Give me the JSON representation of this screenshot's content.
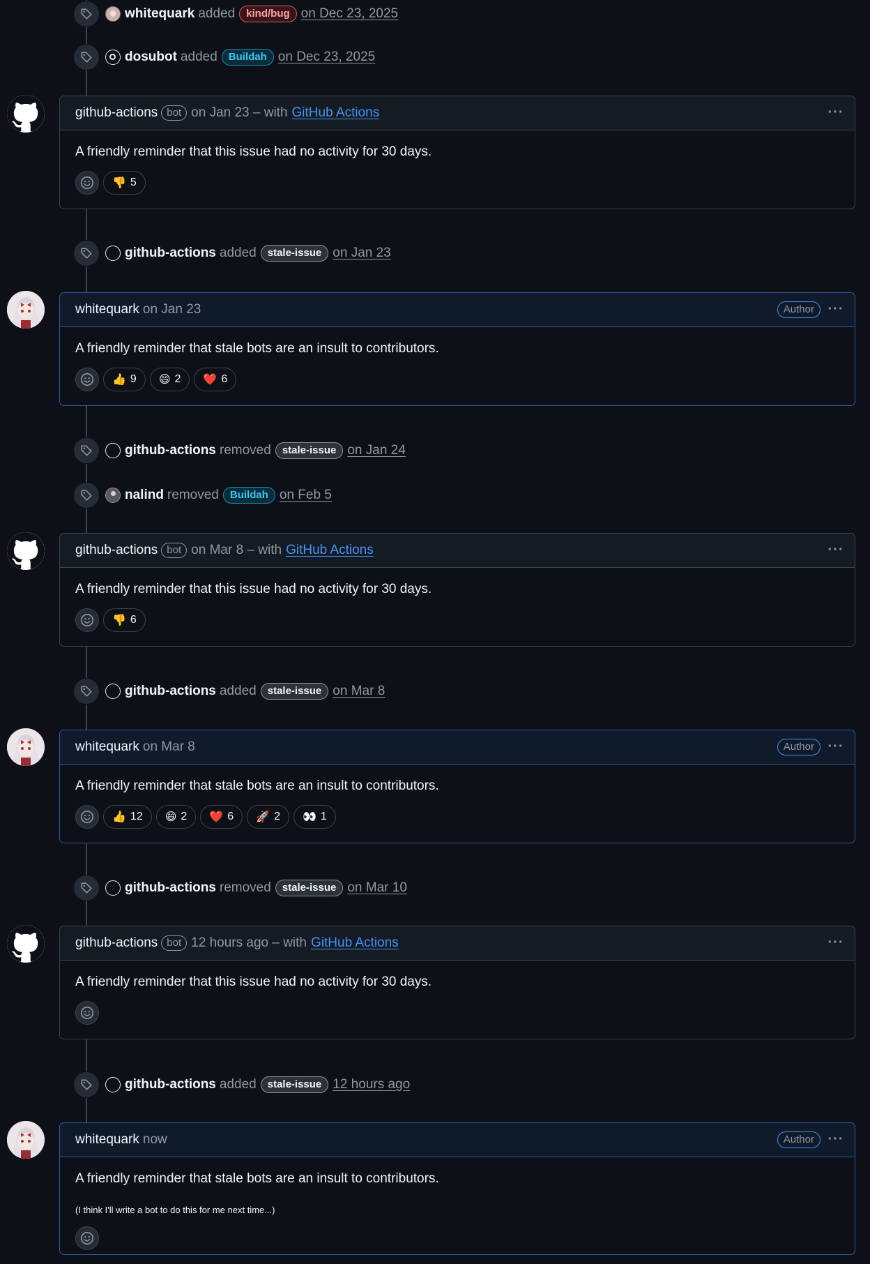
{
  "events": [
    {
      "actor": "whitequark",
      "verb": "added",
      "label": "kind/bug",
      "label_style": "bug",
      "date": "on Dec 23, 2025",
      "avatar": "anime"
    },
    {
      "actor": "dosubot",
      "verb": "added",
      "label": "Buildah",
      "label_style": "buildah",
      "date": "on Dec 23, 2025",
      "avatar": "dosu"
    },
    {
      "actor": "github-actions",
      "verb": "added",
      "label": "stale-issue",
      "label_style": "stale",
      "date": "on Jan 23",
      "avatar": "gh"
    },
    {
      "actor": "github-actions",
      "verb": "removed",
      "label": "stale-issue",
      "label_style": "stale",
      "date": "on Jan 24",
      "avatar": "gh"
    },
    {
      "actor": "nalind",
      "verb": "removed",
      "label": "Buildah",
      "label_style": "buildah",
      "date": "on Feb 5",
      "avatar": "nalind"
    },
    {
      "actor": "github-actions",
      "verb": "added",
      "label": "stale-issue",
      "label_style": "stale",
      "date": "on Mar 8",
      "avatar": "gh"
    },
    {
      "actor": "github-actions",
      "verb": "removed",
      "label": "stale-issue",
      "label_style": "stale",
      "date": "on Mar 10",
      "avatar": "gh"
    },
    {
      "actor": "github-actions",
      "verb": "added",
      "label": "stale-issue",
      "label_style": "stale",
      "date": "12 hours ago",
      "avatar": "gh"
    }
  ],
  "comments": [
    {
      "author": "github-actions",
      "bot_badge": "bot",
      "meta": "on Jan 23 – with",
      "link": "GitHub Actions",
      "body": "A friendly reminder that this issue had no activity for 30 days.",
      "reactions": [
        {
          "emoji": "👎",
          "count": "5"
        }
      ]
    },
    {
      "author": "whitequark",
      "author_badge": "Author",
      "meta": "on Jan 23",
      "body": "A friendly reminder that stale bots are an insult to contributors.",
      "reactions": [
        {
          "emoji": "👍",
          "count": "9"
        },
        {
          "emoji": "😄",
          "count": "2"
        },
        {
          "emoji": "❤️",
          "count": "6"
        }
      ]
    },
    {
      "author": "github-actions",
      "bot_badge": "bot",
      "meta": "on Mar 8 – with",
      "link": "GitHub Actions",
      "body": "A friendly reminder that this issue had no activity for 30 days.",
      "reactions": [
        {
          "emoji": "👎",
          "count": "6"
        }
      ]
    },
    {
      "author": "whitequark",
      "author_badge": "Author",
      "meta": "on Mar 8",
      "body": "A friendly reminder that stale bots are an insult to contributors.",
      "reactions": [
        {
          "emoji": "👍",
          "count": "12"
        },
        {
          "emoji": "😄",
          "count": "2"
        },
        {
          "emoji": "❤️",
          "count": "6"
        },
        {
          "emoji": "🚀",
          "count": "2"
        },
        {
          "emoji": "👀",
          "count": "1"
        }
      ]
    },
    {
      "author": "github-actions",
      "bot_badge": "bot",
      "meta": "12 hours ago – with",
      "link": "GitHub Actions",
      "body": "A friendly reminder that this issue had no activity for 30 days.",
      "reactions": []
    },
    {
      "author": "whitequark",
      "author_badge": "Author",
      "meta": "now",
      "body": "A friendly reminder that stale bots are an insult to contributors.",
      "note": "(I think I'll write a bot to do this for me next time...)",
      "reactions": []
    }
  ],
  "icons": {
    "event": "tag-icon",
    "menu": "kebab-icon",
    "add_reaction": "smiley-icon",
    "bot_avatar": "github-mark-icon",
    "user_avatar": "anime-avatar-icon"
  },
  "colors": {
    "background": "#0d1117",
    "link": "#4493f8",
    "author_border": "#2f5a9a",
    "bug_label": "#d15e63",
    "buildah_label": "#39c5f5"
  }
}
